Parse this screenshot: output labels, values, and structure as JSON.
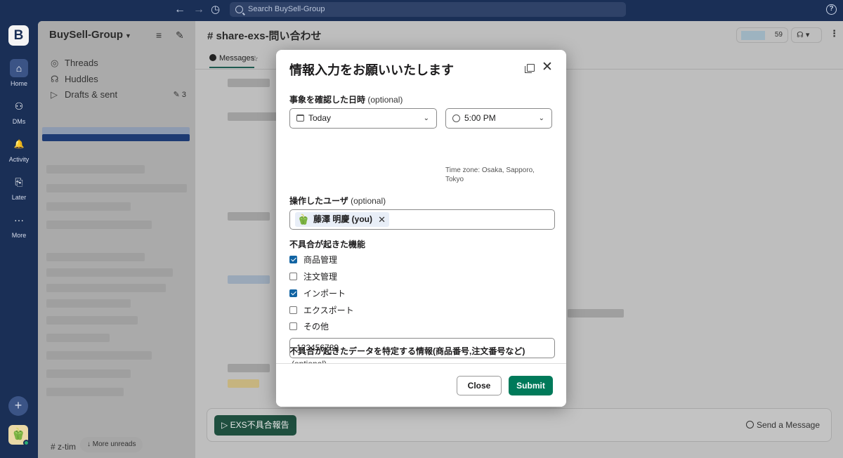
{
  "topbar": {
    "search_placeholder": "Search BuySell-Group",
    "help": "?"
  },
  "rail": {
    "logo": "B",
    "items": [
      {
        "label": "Home",
        "icon": "home-icon",
        "glyph": "⌂"
      },
      {
        "label": "DMs",
        "icon": "dm-icon",
        "glyph": "⚇"
      },
      {
        "label": "Activity",
        "icon": "bell-icon",
        "glyph": "🔔"
      },
      {
        "label": "Later",
        "icon": "bookmark-icon",
        "glyph": "⎘"
      },
      {
        "label": "More",
        "icon": "ellipsis-icon",
        "glyph": "···"
      }
    ],
    "add": "+",
    "avatar": "🫑"
  },
  "sidebar": {
    "workspace": "BuySell-Group",
    "items": [
      {
        "label": "Threads",
        "glyph": "◎"
      },
      {
        "label": "Huddles",
        "glyph": "☊"
      },
      {
        "label": "Drafts & sent",
        "glyph": "▷"
      }
    ],
    "drafts_count": "3",
    "more_unreads": "More unreads",
    "bottom_channel": "z-tim"
  },
  "channel": {
    "title": "share-exs-問い合わせ",
    "tab_messages": "Messages",
    "member_count": "59",
    "workflow_button": "▷ EXS不具合報告",
    "send_label": "Send a Message"
  },
  "modal": {
    "title": "情報入力をお願いいたします",
    "datetime_label": "事象を確認した日時",
    "optional": "(optional)",
    "date_value": "Today",
    "time_value": "5:00 PM",
    "timezone": "Time zone: Osaka, Sapporo, Tokyo",
    "user_label": "操作したユーザ",
    "user_chip": "藤澤 明慶 (you)",
    "feature_label": "不具合が起きた機能",
    "features": [
      {
        "label": "商品管理",
        "checked": true
      },
      {
        "label": "注文管理",
        "checked": false
      },
      {
        "label": "インポート",
        "checked": true
      },
      {
        "label": "エクスポート",
        "checked": false
      },
      {
        "label": "その他",
        "checked": false
      }
    ],
    "data_label": "不具合が起きたデータを特定する情報(商品番号,注文番号など)",
    "data_value": "123456789",
    "close_label": "Close",
    "submit_label": "Submit"
  }
}
